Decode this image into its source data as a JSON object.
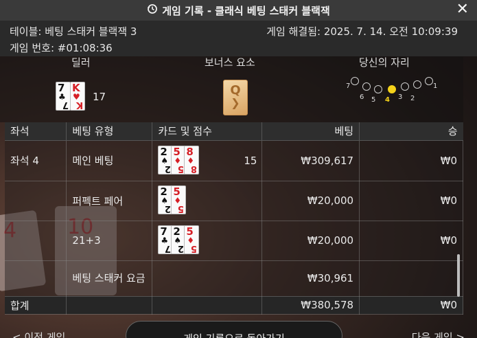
{
  "window": {
    "title": "게임 기록 - 클래식 베팅 스태커 블랙잭"
  },
  "info": {
    "table_label": "테이블: 베팅 스태커 블랙잭 3",
    "resolved_label": "게임 해결됨: 2025. 7. 14. 오전 10:09:39",
    "game_number_label": "게임 번호: #01:08:36"
  },
  "round": {
    "dealer_header": "딜러",
    "bonus_header": "보너스 요소",
    "your_seat_header": "당신의 자리",
    "dealer_cards": [
      {
        "rank": "7",
        "suit": "♣",
        "color": "#111111"
      },
      {
        "rank": "K",
        "suit": "♥",
        "color": "#d61f26"
      }
    ],
    "dealer_score": "17",
    "bonus_card": {
      "rank": "Q"
    },
    "seats": [
      "7",
      "6",
      "5",
      "4",
      "3",
      "2",
      "1"
    ],
    "active_seat": "4"
  },
  "table": {
    "headers": [
      "좌석",
      "베팅 유형",
      "카드 및 점수",
      "베팅",
      "승"
    ],
    "rows": [
      {
        "seat": "좌석 4",
        "bet_type": "메인 베팅",
        "score": "15",
        "bet": "₩309,617",
        "win": "₩0",
        "cards": [
          {
            "rank": "2",
            "suit": "♠"
          },
          {
            "rank": "5",
            "suit": "♦"
          },
          {
            "rank": "8",
            "suit": "♦"
          }
        ]
      },
      {
        "seat": "",
        "bet_type": "퍼펙트 페어",
        "score": "",
        "bet": "₩20,000",
        "win": "₩0",
        "cards": [
          {
            "rank": "2",
            "suit": "♠"
          },
          {
            "rank": "5",
            "suit": "♦"
          }
        ]
      },
      {
        "seat": "",
        "bet_type": "21+3",
        "score": "",
        "bet": "₩20,000",
        "win": "₩0",
        "cards": [
          {
            "rank": "7",
            "suit": "♣"
          },
          {
            "rank": "2",
            "suit": "♠"
          },
          {
            "rank": "5",
            "suit": "♦"
          }
        ]
      },
      {
        "seat": "",
        "bet_type": "베팅 스태커 요금",
        "score": "",
        "bet": "₩30,961",
        "win": "",
        "cards": []
      }
    ],
    "total": {
      "label": "합계",
      "bet": "₩380,578",
      "win": "₩0"
    }
  },
  "footer": {
    "prev_label": "< 이전 게임",
    "back_label": "게임 기록으로 돌아가기",
    "next_label": "다음 게임 >"
  },
  "colors": {
    "accent_seat": "#f4d21a",
    "red_suit": "#d61f26",
    "header_bg": "#2e2e2e"
  },
  "icons": {
    "title": "history-icon",
    "close": "close-icon"
  }
}
